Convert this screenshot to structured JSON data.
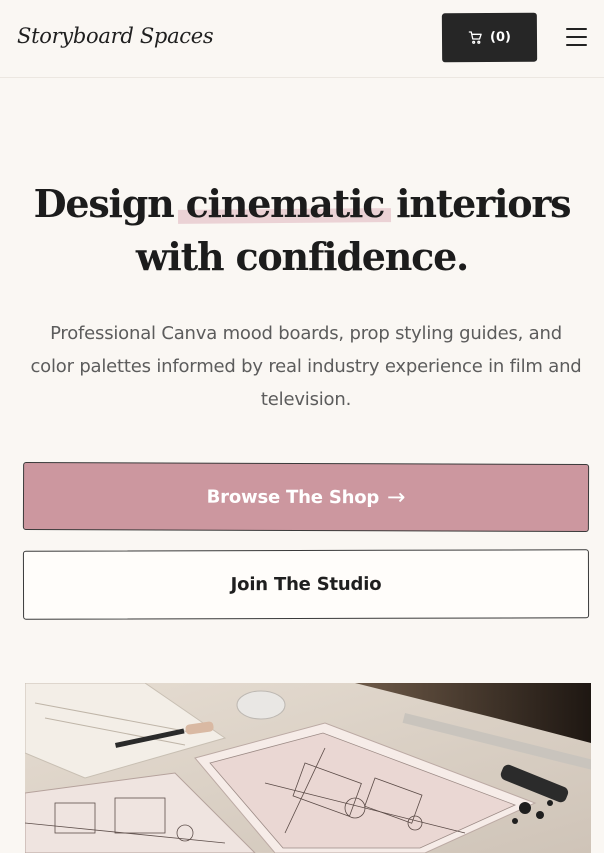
{
  "header": {
    "logo": "Storyboard Spaces",
    "cart_label": "(0)",
    "cart_icon": "cart-icon",
    "menu_icon": "hamburger-menu-icon"
  },
  "hero": {
    "title_part1": "Design ",
    "title_highlight": "cinematic",
    "title_part2": " interiors with confidence.",
    "subtitle": "Professional Canva mood boards, prop styling guides, and color palettes informed by real industry experience in film and television."
  },
  "buttons": {
    "primary_label": "Browse The Shop",
    "primary_arrow": "→",
    "secondary_label": "Join The Studio"
  },
  "colors": {
    "accent": "#cc979f",
    "highlight": "#e3bfc8",
    "dark": "#262626",
    "background": "#faf7f3"
  }
}
